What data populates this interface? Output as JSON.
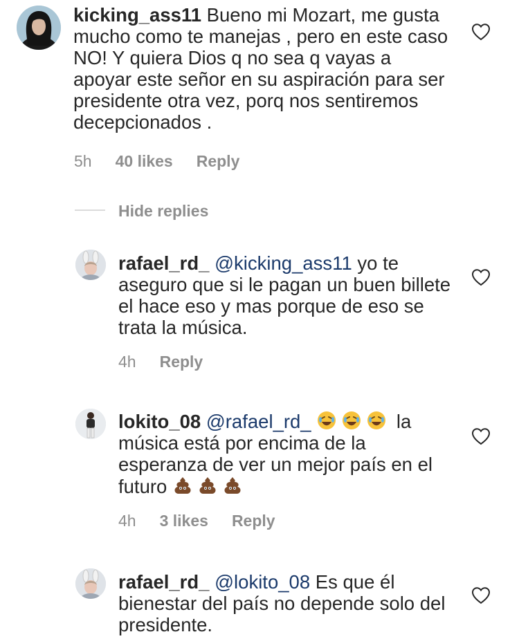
{
  "comments": [
    {
      "username": "kicking_ass11",
      "mention": "",
      "text": " Bueno mi Mozart, me gusta mucho como te manejas , pero en este caso NO! Y quiera Dios q no sea q vayas a apoyar este señor en su aspiración para ser presidente otra vez, porq nos sentiremos decepcionados .",
      "time": "5h",
      "likes": "40 likes",
      "reply": "Reply",
      "avatar_icon": "user-avatar-dark-hair"
    }
  ],
  "hide_replies_label": "Hide replies",
  "replies": [
    {
      "username": "rafael_rd_",
      "mention": "@kicking_ass11",
      "text": " yo te aseguro que si le pagan un buen billete el hace eso y mas porque de eso se trata la música.",
      "time": "4h",
      "likes": "",
      "reply": "Reply",
      "avatar_icon": "user-avatar-bunny-ears"
    },
    {
      "username": "lokito_08",
      "mention": "@rafael_rd_",
      "emoji_prefix": "rolling-on-floor-laughing-emoji x3",
      "text": " la música está por encima de la esperanza de ver un mejor país en el futuro",
      "emoji_suffix": "pile-of-poo-emoji x3",
      "time": "4h",
      "likes": "3 likes",
      "reply": "Reply",
      "avatar_icon": "user-avatar-standing-figure"
    },
    {
      "username": "rafael_rd_",
      "mention": "@lokito_08",
      "text": " Es que él bienestar del país no depende solo del presidente.",
      "time": "",
      "likes": "",
      "reply": "",
      "avatar_icon": "user-avatar-bunny-ears"
    }
  ],
  "icons": {
    "like": "heart-outline-icon"
  },
  "colors": {
    "text": "#262626",
    "meta": "#8e8e8e",
    "mention": "#1b3a6b",
    "divider": "#dbdbdb"
  }
}
